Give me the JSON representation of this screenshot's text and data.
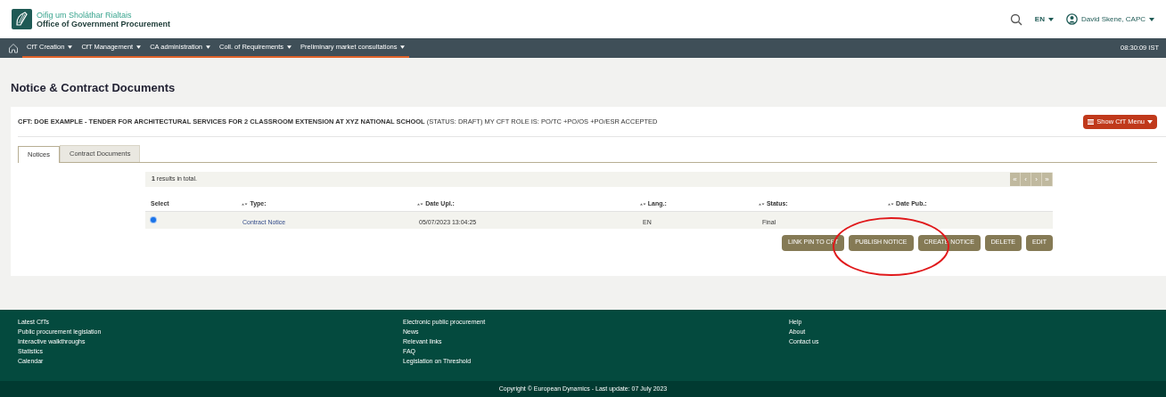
{
  "header": {
    "logo_line1": "Oifig um Sholáthar Rialtais",
    "logo_line2": "Office of Government Procurement",
    "language": "EN",
    "user": "David Skene, CAPC"
  },
  "nav": {
    "items": [
      {
        "label": "CfT Creation",
        "selected": true
      },
      {
        "label": "CfT Management",
        "selected": true
      },
      {
        "label": "CA administration",
        "selected": true
      },
      {
        "label": "Coll. of Requirements",
        "selected": true
      },
      {
        "label": "Preliminary market consultations",
        "selected": true
      }
    ],
    "time": "08:30:09 IST"
  },
  "page_title": "Notice & Contract Documents",
  "cft_line": "**CFT: DOE EXAMPLE - TENDER FOR ARCHITECTURAL SERVICES FOR 2 CLASSROOM EXTENSION AT XYZ NATIONAL SCHOOL** (STATUS: DRAFT) MY CFT ROLE IS: PO/TC +PO/OS +PO/ESR ACCEPTED",
  "cft_menu_button": "Show CfT Menu",
  "tabs": [
    {
      "label": "Notices",
      "selected": true
    },
    {
      "label": "Contract Documents",
      "selected": false
    }
  ],
  "results": "**1** results in total.",
  "pager": [
    "«",
    "‹",
    "›",
    "»"
  ],
  "table": {
    "columns": [
      {
        "label": "Select",
        "sortable": false
      },
      {
        "label": "Type:",
        "sortable": true
      },
      {
        "label": "Date Upl.:",
        "sortable": true
      },
      {
        "label": "Lang.:",
        "sortable": true
      },
      {
        "label": "Status:",
        "sortable": true
      },
      {
        "label": "Date Pub.:",
        "sortable": true
      }
    ],
    "rows": [
      {
        "selected": true,
        "cells": [
          "",
          "Contract Notice",
          "05/07/2023 13:04:25",
          "EN",
          "Final"
        ]
      }
    ]
  },
  "actions": [
    "LINK PIN TO CFT",
    "PUBLISH NOTICE",
    "CREATE NOTICE",
    "DELETE",
    "EDIT"
  ],
  "footer": {
    "columns": [
      [
        "Latest CfTs",
        "Public procurement legislation",
        "Interactive walkthroughs",
        "Statistics",
        "Calendar"
      ],
      [
        "Electronic public procurement",
        "News",
        "Relevant links",
        "FAQ",
        "Legislation on Threshold"
      ],
      [
        "Help",
        "About",
        "Contact us"
      ]
    ],
    "copyright": "Copyright © European Dynamics - Last update: 07 July 2023"
  }
}
